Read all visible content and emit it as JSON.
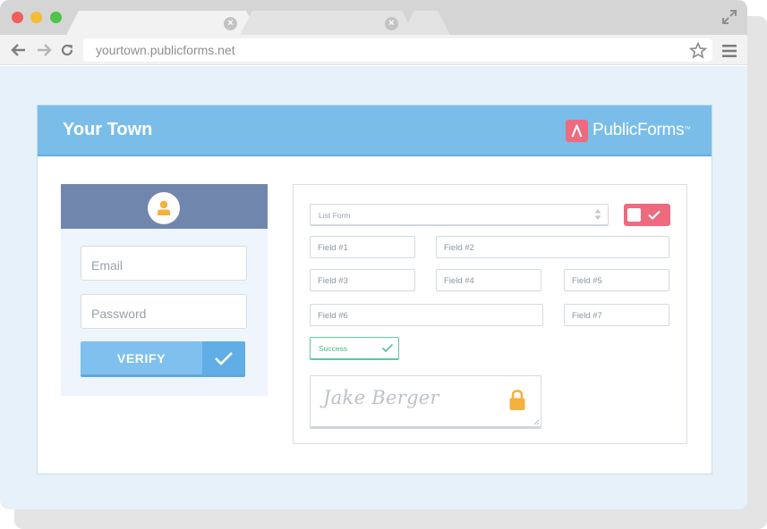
{
  "browser": {
    "url": "yourtown.publicforms.net",
    "traffic_lights": [
      "#f05f5a",
      "#f5bc36",
      "#4ec44a"
    ]
  },
  "header": {
    "title": "Your Town",
    "brand_name": "PublicForms",
    "brand_tm": "™",
    "brand_color": "#ee6a7f"
  },
  "login": {
    "email_placeholder": "Email",
    "password_placeholder": "Password",
    "verify_label": "VERIFY"
  },
  "form": {
    "list_label": "List Form",
    "fields": [
      "Field #1",
      "Field #2",
      "Field #3",
      "Field #4",
      "Field #5",
      "Field #6",
      "Field #7"
    ],
    "success_label": "Success",
    "signature": "Jake Berger"
  },
  "colors": {
    "header_blue": "#7abde9",
    "login_header": "#7186ad",
    "verify_blue": "#7fc0ee",
    "success_green": "#5ec8a0",
    "lock_orange": "#f5b13d"
  }
}
